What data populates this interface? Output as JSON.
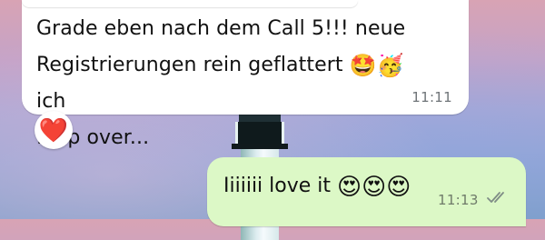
{
  "chat": {
    "incoming_message": {
      "text_line1": "Grade eben nach dem Call 5!!! neue",
      "text_line2": "Registrierungen rein geflattert",
      "emoji1": "🤩",
      "emoji2": "🥳",
      "text_after_emojis": "ich",
      "text_line3": "flipp over...",
      "time": "11:11",
      "reaction": "❤️"
    },
    "outgoing_message": {
      "text": "Iiiiiii love it",
      "emojis": "😍😍😍",
      "time": "11:13",
      "status_icon": "double-check-icon"
    }
  },
  "colors": {
    "outgoing_bubble": "#dcf8c6",
    "incoming_bubble": "#ffffff",
    "reaction_heart": "#e3223a",
    "timestamp_gray": "#6f7478"
  }
}
